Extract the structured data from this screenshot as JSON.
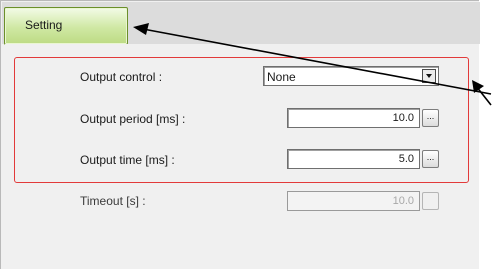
{
  "tab": {
    "label": "Setting"
  },
  "fields": {
    "output_control": {
      "label": "Output control :",
      "value": "None"
    },
    "output_period": {
      "label": "Output period [ms] :",
      "value": "10.0",
      "button": "..."
    },
    "output_time": {
      "label": "Output time [ms] :",
      "value": "5.0",
      "button": "..."
    },
    "timeout": {
      "label": "Timeout [s] :",
      "value": "10.0",
      "enabled": false
    }
  },
  "annotation": {
    "arrow_color": "#000000"
  },
  "colors": {
    "tab_fill": "#cfe8a3",
    "group_border": "#e23a3a",
    "panel_background": "#f0f0f0"
  }
}
